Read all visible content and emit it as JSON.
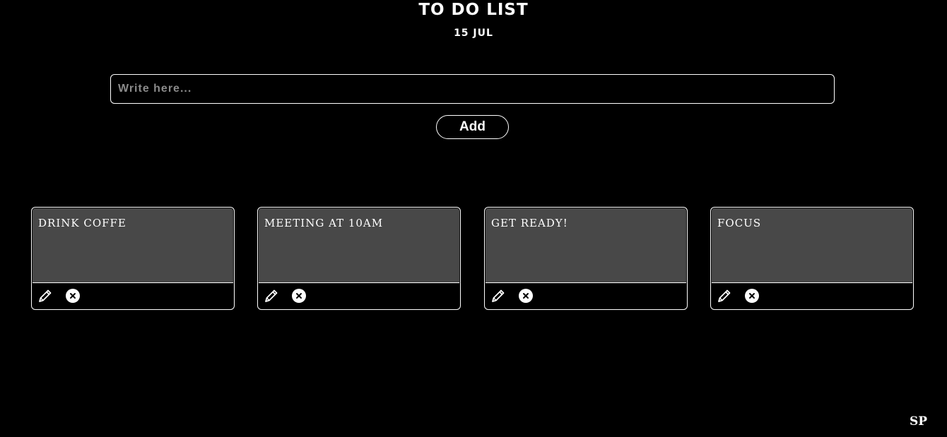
{
  "header": {
    "title": "TO DO LIST",
    "date": "15 JUL"
  },
  "input": {
    "placeholder": "Write here...",
    "value": ""
  },
  "add_button": {
    "label": "Add"
  },
  "tasks": [
    {
      "text": "DRINK COFFE"
    },
    {
      "text": "MEETING AT 10AM"
    },
    {
      "text": "GET READY!"
    },
    {
      "text": "FOCUS"
    }
  ],
  "icons": {
    "edit": "pencil-icon",
    "delete": "close-circle-icon"
  },
  "colors": {
    "background": "#000000",
    "card_body": "#484848",
    "text": "#ffffff",
    "placeholder": "#8a8a8a"
  },
  "footer": {
    "logo": "SP"
  }
}
